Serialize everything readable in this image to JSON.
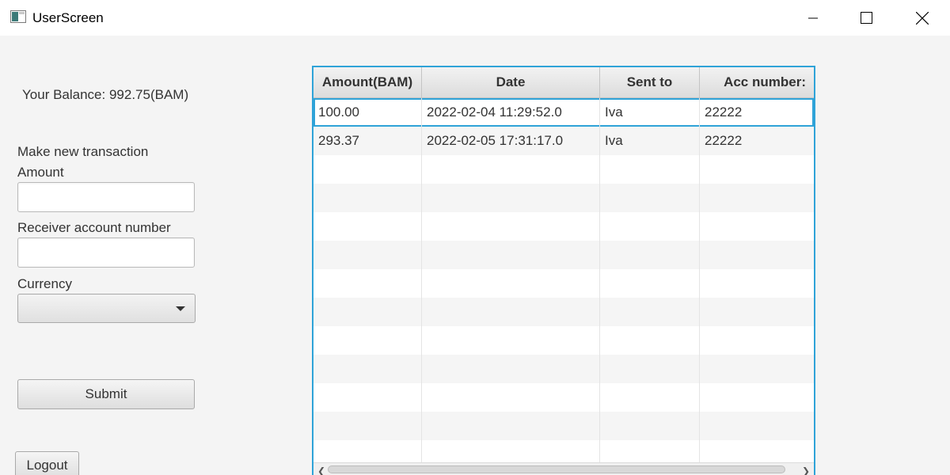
{
  "window": {
    "title": "UserScreen"
  },
  "balance": {
    "text": "Your Balance: 992.75(BAM)"
  },
  "form": {
    "section_title": "Make new transaction",
    "amount_label": "Amount",
    "amount_value": "",
    "receiver_label": "Receiver account number",
    "receiver_value": "",
    "currency_label": "Currency",
    "currency_value": "",
    "submit_label": "Submit"
  },
  "logout": {
    "label": "Logout"
  },
  "table": {
    "columns": [
      "Amount(BAM)",
      "Date",
      "Sent to",
      "Acc number:"
    ],
    "rows": [
      [
        "100.00",
        "2022-02-04 11:29:52.0",
        "Iva",
        "22222"
      ],
      [
        "293.37",
        "2022-02-05 17:31:17.0",
        "Iva",
        "22222"
      ]
    ],
    "selected_row": 0
  },
  "colors": {
    "focus": "#2fa3d8"
  }
}
